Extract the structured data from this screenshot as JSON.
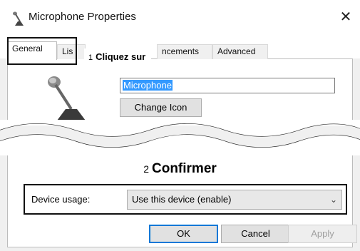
{
  "window": {
    "title": "Microphone Properties",
    "close_glyph": "✕"
  },
  "tabs": [
    {
      "label": "General",
      "active": true
    },
    {
      "label": "Lis"
    },
    {
      "label": "ncements"
    },
    {
      "label": "Advanced"
    }
  ],
  "callout1": {
    "number": "1",
    "text": "Cliquez sur"
  },
  "general": {
    "device_name": "Microphone",
    "change_icon_label": "Change Icon"
  },
  "callout2": {
    "number": "2",
    "text": "Confirmer"
  },
  "device_usage": {
    "label": "Device usage:",
    "selected": "Use this device (enable)"
  },
  "buttons": {
    "ok": "OK",
    "cancel": "Cancel",
    "apply": "Apply"
  },
  "colors": {
    "selection": "#3399ff",
    "ok_border": "#0078d7"
  },
  "icons": {
    "title": "microphone-icon",
    "device": "microphone-icon"
  }
}
